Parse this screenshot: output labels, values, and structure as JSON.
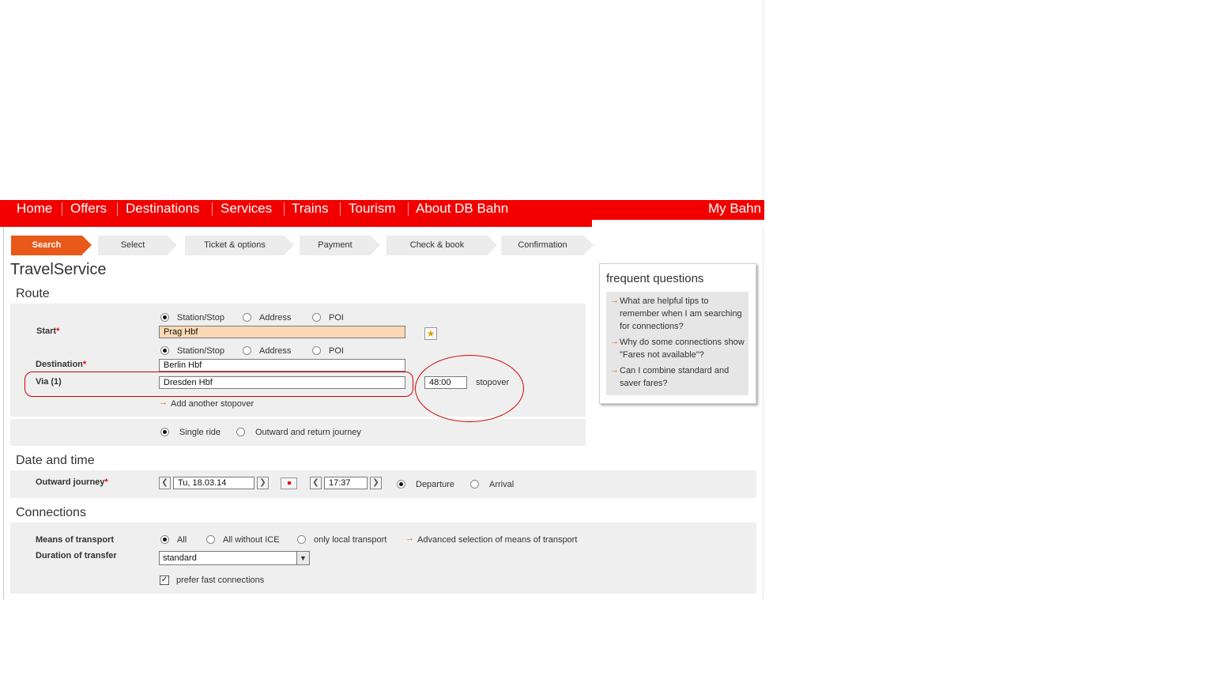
{
  "nav": {
    "items": [
      "Home",
      "Offers",
      "Destinations",
      "Services",
      "Trains",
      "Tourism",
      "About DB Bahn"
    ],
    "my_bahn": "My Bahn"
  },
  "steps": [
    "Search",
    "Select",
    "Ticket & options",
    "Payment",
    "Check & book",
    "Confirmation"
  ],
  "page_title": "TravelService",
  "route": {
    "heading": "Route",
    "location_types": [
      "Station/Stop",
      "Address",
      "POI"
    ],
    "start_label": "Start",
    "start_value": "Prag Hbf",
    "destination_label": "Destination",
    "destination_value": "Berlin Hbf",
    "via_label": "Via (1)",
    "via_value": "Dresden Hbf",
    "stopover_value": "48:00",
    "stopover_label": "stopover",
    "add_stopover": "Add another stopover",
    "single_ride": "Single ride",
    "return_journey": "Outward and return journey",
    "required_mark": "*"
  },
  "datetime": {
    "heading": "Date and time",
    "outward_label": "Outward journey",
    "date_value": "Tu, 18.03.14",
    "time_value": "17:37",
    "departure": "Departure",
    "arrival": "Arrival"
  },
  "connections": {
    "heading": "Connections",
    "means_label": "Means of transport",
    "opt_all": "All",
    "opt_no_ice": "All without ICE",
    "opt_local": "only local transport",
    "advanced": "Advanced selection of means of transport",
    "transfer_label": "Duration of transfer",
    "transfer_value": "standard",
    "prefer_fast": "prefer fast connections"
  },
  "faq": {
    "title": "frequent questions",
    "items": [
      "What are helpful tips to remember when I am searching for connections?",
      "Why do some connections show \"Fares not available\"?",
      "Can I combine standard and saver fares?"
    ]
  },
  "colors": {
    "db_red": "#f20000",
    "step_active": "#e8591a",
    "highlight_input": "#fcd9b4"
  },
  "icons": {
    "favorite": "star-icon",
    "calendar": "calendar-icon",
    "link_arrow": "arrow-right-icon"
  }
}
